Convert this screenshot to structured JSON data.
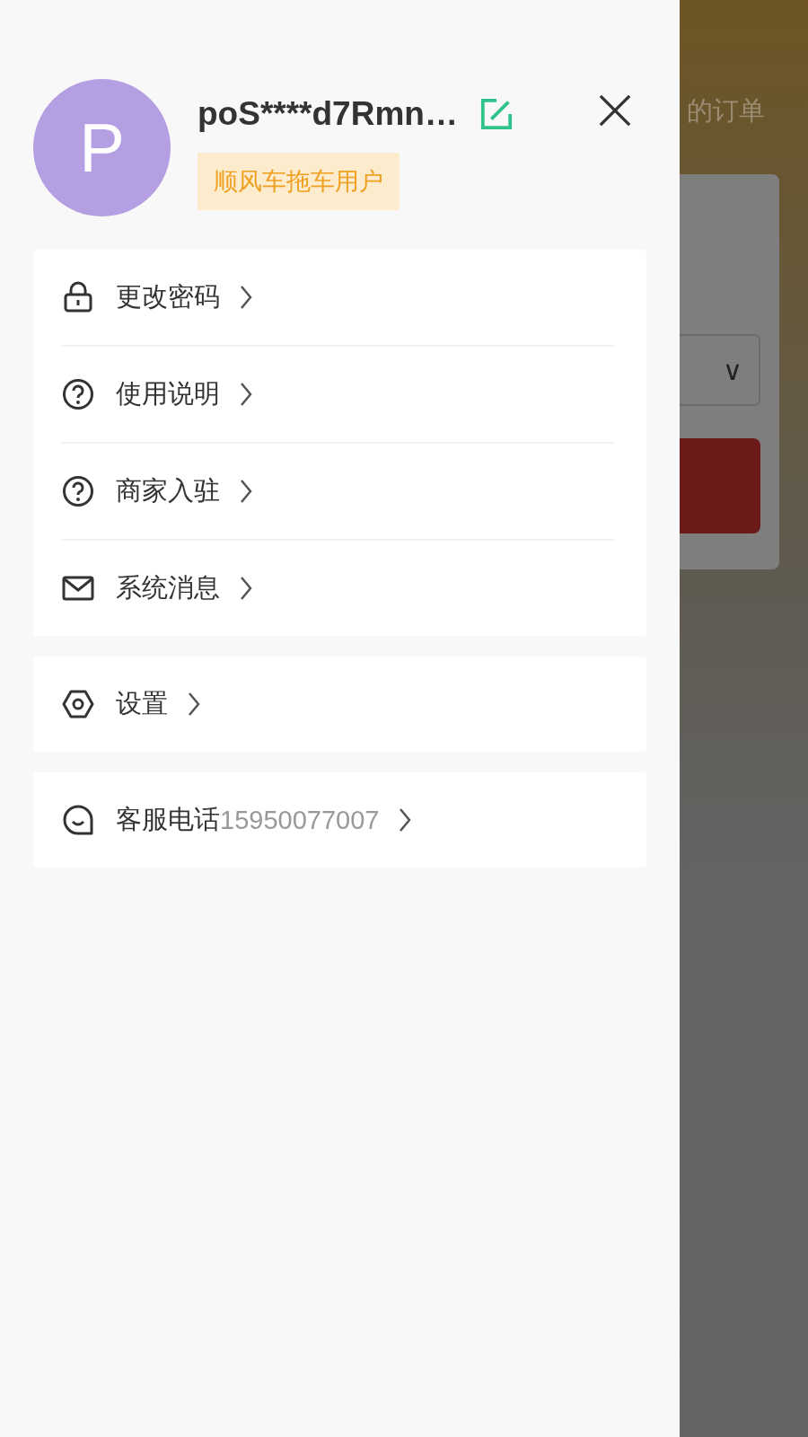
{
  "background_page": {
    "header_title": "的订单",
    "dropdown": {
      "caret": "∨"
    }
  },
  "drawer": {
    "user": {
      "avatar_letter": "P",
      "name": "poS****d7Rmn…",
      "tag": "顺风车拖车用户"
    },
    "menu_groups": [
      {
        "items": [
          {
            "kind": "lock",
            "label": "更改密码"
          },
          {
            "kind": "help",
            "label": "使用说明"
          },
          {
            "kind": "help",
            "label": "商家入驻"
          },
          {
            "kind": "mail",
            "label": "系统消息"
          }
        ]
      },
      {
        "items": [
          {
            "kind": "settings",
            "label": "设置"
          }
        ]
      },
      {
        "items": [
          {
            "kind": "chat",
            "label": "客服电话",
            "detail": "15950077007"
          }
        ]
      }
    ]
  }
}
